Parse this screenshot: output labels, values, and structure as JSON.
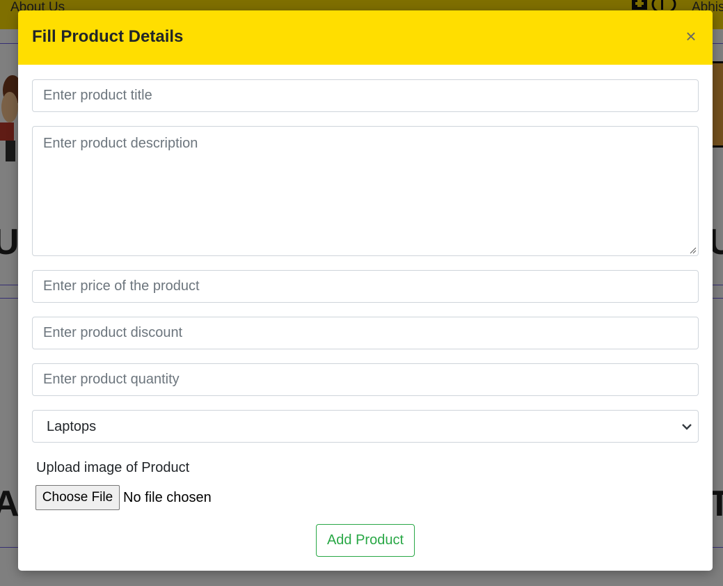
{
  "background": {
    "nav_link": "About Us",
    "user_partial": "Abhis",
    "left_letters": [
      "US",
      "AI"
    ],
    "right_letters": [
      "U",
      "T"
    ]
  },
  "modal": {
    "title": "Fill Product Details",
    "close_symbol": "×",
    "fields": {
      "title_placeholder": "Enter product title",
      "description_placeholder": "Enter product description",
      "price_placeholder": "Enter price of the product",
      "discount_placeholder": "Enter product discount",
      "quantity_placeholder": "Enter product quantity"
    },
    "category_select": {
      "selected": "Laptops"
    },
    "upload": {
      "label": "Upload image of Product",
      "button_label": "Choose File",
      "status": "No file chosen"
    },
    "submit_label": "Add Product"
  },
  "colors": {
    "header_yellow": "#ffde00",
    "success_green": "#28a745"
  },
  "icons": {
    "close": "close-icon",
    "select_arrow": "chevron-down-icon",
    "cart": "cart-icon",
    "resize": "resize-grip-icon"
  }
}
